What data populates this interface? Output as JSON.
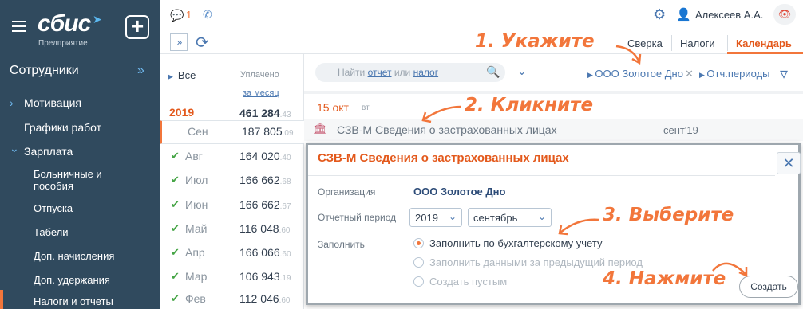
{
  "sidebar": {
    "logo": "сбис",
    "logo_sub": "Предприятие",
    "plus": "+",
    "section_title": "Сотрудники",
    "collapse": "»",
    "items": [
      {
        "label": "Мотивация",
        "chevron": "›"
      },
      {
        "label": "Графики работ"
      },
      {
        "label": "Зарплата",
        "chevron": "⌄"
      },
      {
        "label": "Больничные и пособия"
      },
      {
        "label": "Отпуска"
      },
      {
        "label": "Табели"
      },
      {
        "label": "Доп. начисления"
      },
      {
        "label": "Доп. удержания"
      },
      {
        "label": "Налоги и отчеты"
      }
    ]
  },
  "topbar": {
    "chat_icon": "chat-icon",
    "chat_count": "1",
    "user_name": "Алексеев А.А.",
    "expand": "»",
    "tabs": [
      {
        "label": "Сверка"
      },
      {
        "label": "Налоги"
      },
      {
        "label": "Календарь",
        "active": true
      }
    ]
  },
  "months": {
    "all_label": "Все",
    "paid_label": "Уплачено",
    "per_month_label": "за месяц",
    "year": "2019",
    "year_sum": "461 284",
    "year_kop": ".43",
    "rows": [
      {
        "month": "Сен",
        "sum": "187 805",
        "kop": ".09",
        "selected": true
      },
      {
        "month": "Авг",
        "sum": "164 020",
        "kop": ".40"
      },
      {
        "month": "Июл",
        "sum": "166 662",
        "kop": ".68"
      },
      {
        "month": "Июн",
        "sum": "166 662",
        "kop": ".67"
      },
      {
        "month": "Май",
        "sum": "116 048",
        "kop": ".60"
      },
      {
        "month": "Апр",
        "sum": "166 066",
        "kop": ".60"
      },
      {
        "month": "Мар",
        "sum": "106 943",
        "kop": ".19"
      },
      {
        "month": "Фев",
        "sum": "112 046",
        "kop": ".60"
      }
    ]
  },
  "search": {
    "prefix": "Найти ",
    "link1": "отчет",
    "mid": " или ",
    "link2": "налог"
  },
  "filters": {
    "org": "ООО Золотое Дно",
    "period": "Отч.периоды"
  },
  "calendar": {
    "day": "15  окт",
    "dow": "вт",
    "doc_title": "СЗВ-М Сведения о застрахованных лицах",
    "doc_period": "сент'19"
  },
  "dialog": {
    "title": "СЗВ-М Сведения о застрахованных лицах",
    "org_label": "Организация",
    "org_value": "ООО Золотое Дно",
    "period_label": "Отчетный период",
    "year": "2019",
    "month": "сентябрь",
    "fill_label": "Заполнить",
    "options": [
      {
        "label": "Заполнить по бухгалтерскому учету",
        "selected": true
      },
      {
        "label": "Заполнить данными за предыдущий период",
        "selected": false
      },
      {
        "label": "Создать пустым",
        "selected": false
      }
    ],
    "create_button": "Создать"
  },
  "annotations": {
    "step1": "1. Укажите",
    "step2": "2. Кликните",
    "step3": "3. Выберите",
    "step4": "4. Нажмите"
  },
  "colors": {
    "sidebar_bg": "#304a5e",
    "accent_orange": "#f2763b",
    "link_blue": "#4a77b0",
    "check_green": "#46a546"
  }
}
